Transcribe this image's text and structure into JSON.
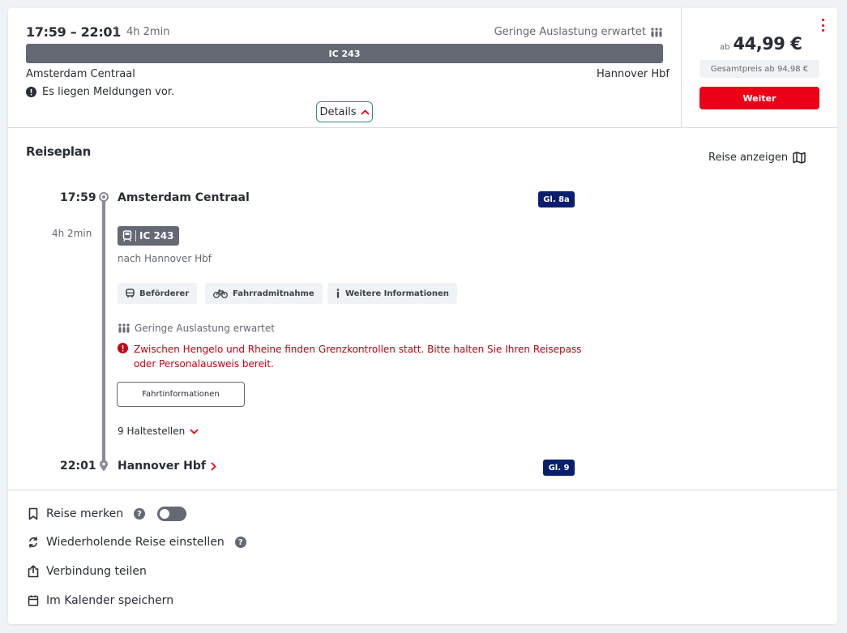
{
  "summary": {
    "times": "17:59 – 22:01",
    "separator": "|",
    "duration": "4h 2min",
    "occupancy": "Geringe Auslastung erwartet",
    "train": "IC 243",
    "from": "Amsterdam Centraal",
    "to": "Hannover Hbf",
    "notice": "Es liegen Meldungen vor.",
    "details_label": "Details"
  },
  "price": {
    "prefix": "ab",
    "value": "44,99 €",
    "total": "Gesamtpreis ab 94,98 €",
    "button": "Weiter"
  },
  "reiseplan": {
    "title": "Reiseplan",
    "show_trip": "Reise anzeigen",
    "departure": {
      "time": "17:59",
      "station": "Amsterdam Centraal",
      "platform": "Gl. 8a"
    },
    "segment": {
      "duration": "4h 2min",
      "train": "IC 243",
      "direction": "nach Hannover Hbf",
      "chips": [
        "Beförderer",
        "Fahrradmitnahme",
        "Weitere Informationen"
      ],
      "occupancy": "Geringe Auslastung erwartet",
      "warning": "Zwischen Hengelo und Rheine finden Grenzkontrollen statt. Bitte halten Sie Ihren Reisepass oder Personalausweis bereit.",
      "info_button": "Fahrtinformationen",
      "stops": "9 Haltestellen"
    },
    "arrival": {
      "time": "22:01",
      "station": "Hannover Hbf",
      "platform": "Gl. 9"
    }
  },
  "actions": {
    "save": "Reise merken",
    "repeat": "Wiederholende Reise einstellen",
    "share": "Verbindung teilen",
    "calendar": "Im Kalender speichern",
    "help_glyph": "?"
  },
  "colors": {
    "accent": "#ec0016",
    "platform": "#0a1e6e",
    "warning": "#c50014",
    "train": "#646973"
  }
}
